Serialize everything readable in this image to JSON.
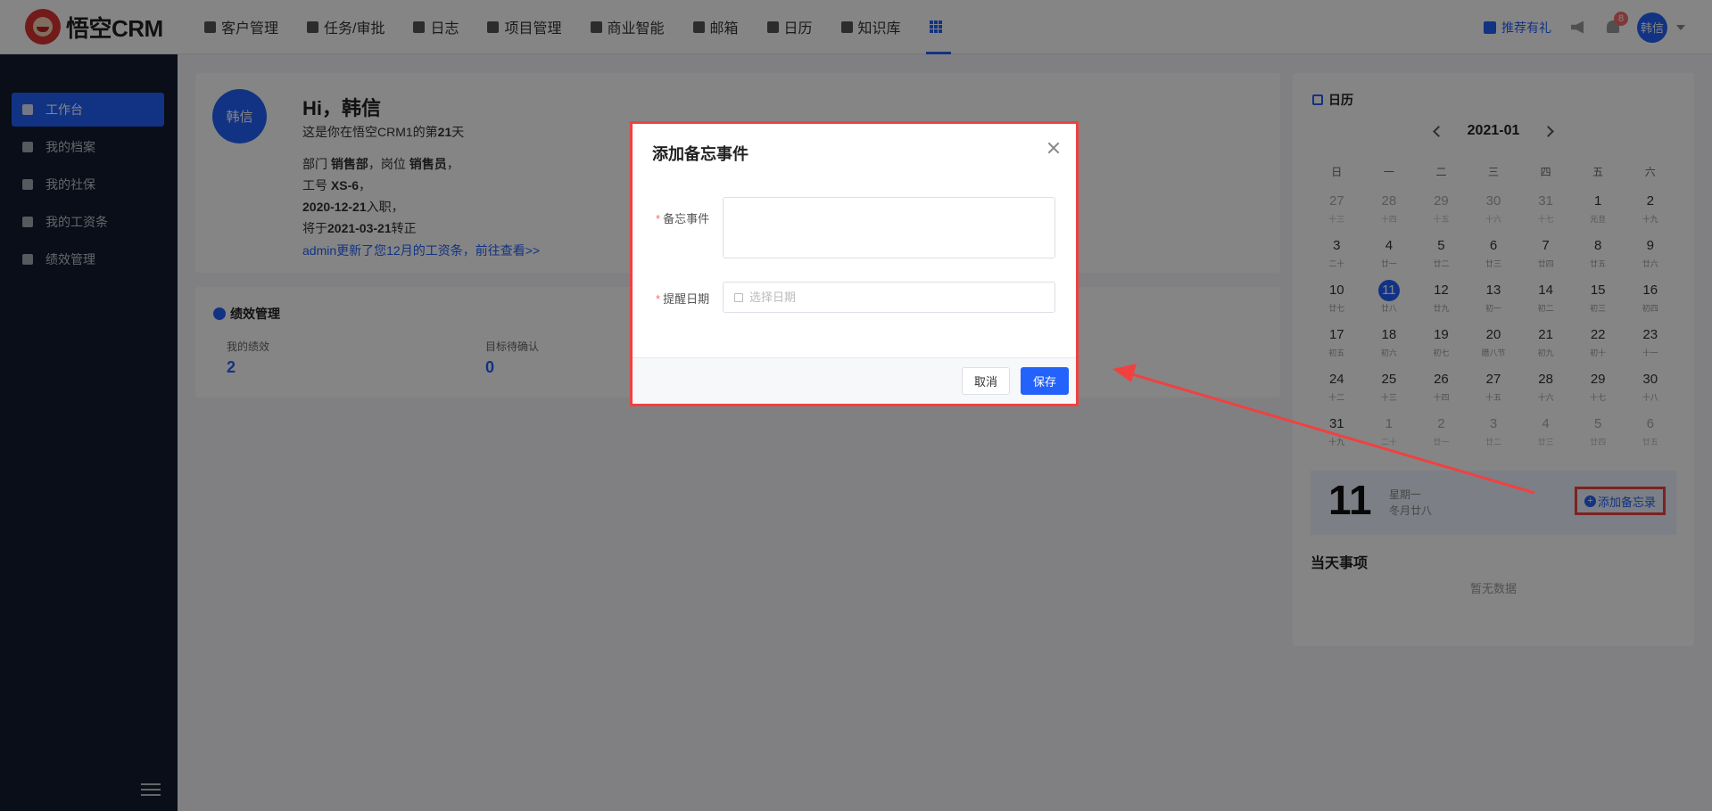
{
  "header": {
    "logo_text": "悟空CRM",
    "nav": [
      {
        "label": "客户管理",
        "icon": "building-icon"
      },
      {
        "label": "任务/审批",
        "icon": "briefcase-icon"
      },
      {
        "label": "日志",
        "icon": "document-icon"
      },
      {
        "label": "项目管理",
        "icon": "kanban-icon"
      },
      {
        "label": "商业智能",
        "icon": "shield-icon"
      },
      {
        "label": "邮箱",
        "icon": "mail-icon"
      },
      {
        "label": "日历",
        "icon": "calendar-icon"
      },
      {
        "label": "知识库",
        "icon": "book-icon"
      },
      {
        "label": "",
        "icon": "apps-grid-icon",
        "active": true
      }
    ],
    "recommend_label": "推荐有礼",
    "notification_count": "8",
    "user_name": "韩信"
  },
  "sidebar": {
    "items": [
      {
        "label": "工作台",
        "icon": "monitor-icon",
        "active": true
      },
      {
        "label": "我的档案",
        "icon": "folder-icon"
      },
      {
        "label": "我的社保",
        "icon": "insurance-icon"
      },
      {
        "label": "我的工资条",
        "icon": "payslip-icon"
      },
      {
        "label": "绩效管理",
        "icon": "chart-icon"
      }
    ]
  },
  "welcome": {
    "avatar_text": "韩信",
    "title": "Hi，韩信",
    "days_prefix": "这是你在悟空CRM1的第",
    "days_value": "21",
    "days_suffix": "天",
    "dept_prefix": "部门",
    "dept_value": "销售部",
    "position_prefix": "，岗位",
    "position_value": "销售员",
    "position_suffix": "，",
    "job_no_prefix": "工号",
    "job_no_value": "XS-6",
    "job_no_suffix": "，",
    "entry_date": "2020-12-21",
    "entry_suffix": "入职，",
    "regular_prefix": "将于",
    "regular_date": "2021-03-21",
    "regular_suffix": "转正",
    "payslip_link": "admin更新了您12月的工资条，前往查看>>"
  },
  "performance": {
    "title": "绩效管理",
    "items": [
      {
        "label": "我的绩效",
        "value": "2"
      },
      {
        "label": "目标待确认",
        "value": "0"
      }
    ]
  },
  "calendar": {
    "title": "日历",
    "month": "2021-01",
    "weekdays": [
      "日",
      "一",
      "二",
      "三",
      "四",
      "五",
      "六"
    ],
    "weeks": [
      [
        {
          "d": "27",
          "l": "十三",
          "m": true
        },
        {
          "d": "28",
          "l": "十四",
          "m": true
        },
        {
          "d": "29",
          "l": "十五",
          "m": true
        },
        {
          "d": "30",
          "l": "十六",
          "m": true
        },
        {
          "d": "31",
          "l": "十七",
          "m": true
        },
        {
          "d": "1",
          "l": "元旦"
        },
        {
          "d": "2",
          "l": "十九"
        }
      ],
      [
        {
          "d": "3",
          "l": "二十"
        },
        {
          "d": "4",
          "l": "廿一"
        },
        {
          "d": "5",
          "l": "廿二"
        },
        {
          "d": "6",
          "l": "廿三"
        },
        {
          "d": "7",
          "l": "廿四"
        },
        {
          "d": "8",
          "l": "廿五"
        },
        {
          "d": "9",
          "l": "廿六"
        }
      ],
      [
        {
          "d": "10",
          "l": "廿七"
        },
        {
          "d": "11",
          "l": "廿八",
          "t": true
        },
        {
          "d": "12",
          "l": "廿九"
        },
        {
          "d": "13",
          "l": "初一"
        },
        {
          "d": "14",
          "l": "初二"
        },
        {
          "d": "15",
          "l": "初三"
        },
        {
          "d": "16",
          "l": "初四"
        }
      ],
      [
        {
          "d": "17",
          "l": "初五"
        },
        {
          "d": "18",
          "l": "初六"
        },
        {
          "d": "19",
          "l": "初七"
        },
        {
          "d": "20",
          "l": "腊八节"
        },
        {
          "d": "21",
          "l": "初九"
        },
        {
          "d": "22",
          "l": "初十"
        },
        {
          "d": "23",
          "l": "十一"
        }
      ],
      [
        {
          "d": "24",
          "l": "十二"
        },
        {
          "d": "25",
          "l": "十三"
        },
        {
          "d": "26",
          "l": "十四"
        },
        {
          "d": "27",
          "l": "十五"
        },
        {
          "d": "28",
          "l": "十六"
        },
        {
          "d": "29",
          "l": "十七"
        },
        {
          "d": "30",
          "l": "十八"
        }
      ],
      [
        {
          "d": "31",
          "l": "十九"
        },
        {
          "d": "1",
          "l": "二十",
          "m": true
        },
        {
          "d": "2",
          "l": "廿一",
          "m": true
        },
        {
          "d": "3",
          "l": "廿二",
          "m": true
        },
        {
          "d": "4",
          "l": "廿三",
          "m": true
        },
        {
          "d": "5",
          "l": "廿四",
          "m": true
        },
        {
          "d": "6",
          "l": "廿五",
          "m": true
        }
      ]
    ],
    "today_day": "11",
    "today_weekday": "星期一",
    "today_lunar": "冬月廿八",
    "add_memo_label": "添加备忘录",
    "events_title": "当天事项",
    "empty_text": "暂无数据"
  },
  "dialog": {
    "title": "添加备忘事件",
    "event_label": "备忘事件",
    "event_value": "",
    "date_label": "提醒日期",
    "date_placeholder": "选择日期",
    "cancel_label": "取消",
    "save_label": "保存"
  },
  "colors": {
    "primary": "#2362fb",
    "sidebar_bg": "#131b2e",
    "highlight_red": "#f04141",
    "required_star": "#f56c6c"
  }
}
